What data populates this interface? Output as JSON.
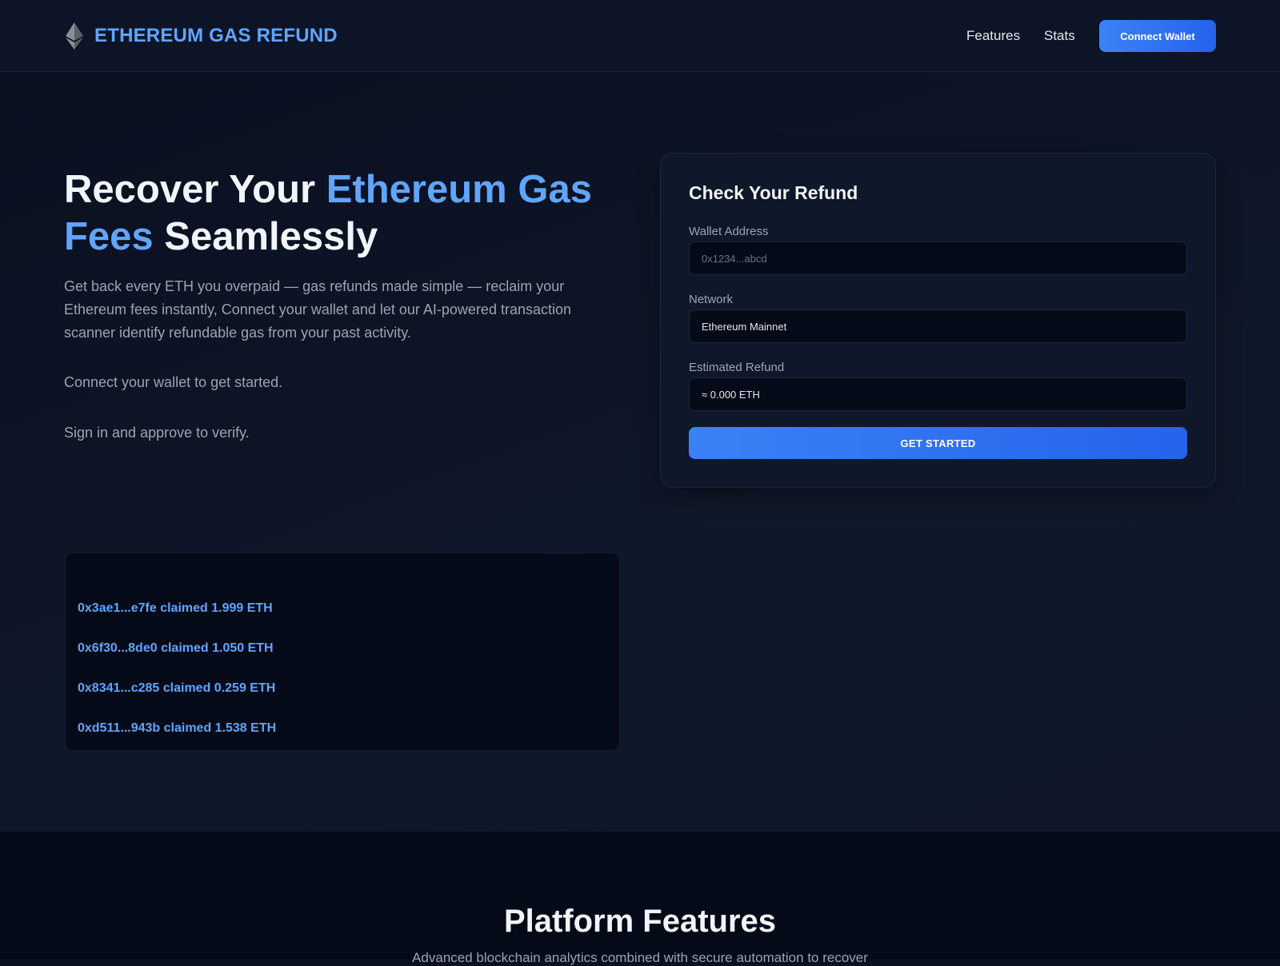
{
  "header": {
    "brand": "ETHEREUM GAS REFUND",
    "nav": [
      "Features",
      "Stats"
    ],
    "connect_label": "Connect Wallet"
  },
  "hero": {
    "title_part1": "Recover Your ",
    "title_accent": "Ethereum Gas Fees",
    "title_part2": " Seamlessly",
    "description": "Get back every ETH you overpaid — gas refunds made simple — reclaim your Ethereum fees instantly, Connect your wallet and let our AI-powered transaction scanner identify refundable gas from your past activity.",
    "line1": "Connect your wallet to get started.",
    "line2": "Sign in and approve to verify."
  },
  "refund_card": {
    "title": "Check Your Refund",
    "wallet_label": "Wallet Address",
    "wallet_placeholder": "0x1234...abcd",
    "network_label": "Network",
    "network_value": "Ethereum Mainnet",
    "refund_label": "Estimated Refund",
    "refund_value": "≈ 0.000 ETH",
    "button_label": "GET STARTED"
  },
  "claims": [
    "0x3ae1...e7fe claimed 1.999 ETH",
    "0x6f30...8de0 claimed 1.050 ETH",
    "0x8341...c285 claimed 0.259 ETH",
    "0xd511...943b claimed 1.538 ETH"
  ],
  "features": {
    "title": "Platform Features",
    "subtitle": "Advanced blockchain analytics combined with secure automation to recover"
  },
  "colors": {
    "accent": "#60a5fa",
    "button": "#3b82f6",
    "background": "#0b1120"
  }
}
